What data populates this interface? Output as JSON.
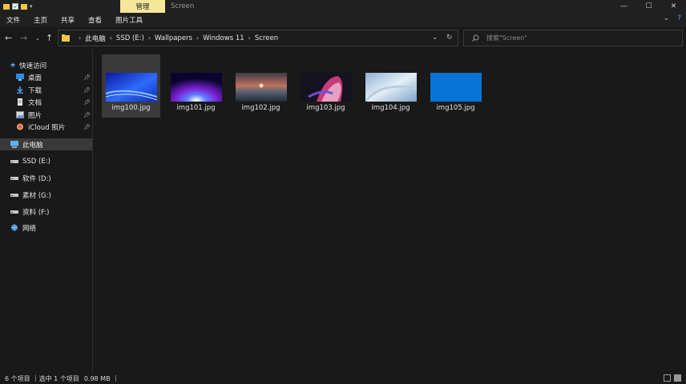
{
  "titlebar": {
    "manage_tab": "管理",
    "window_title": "Screen",
    "minimize": "—",
    "maximize": "☐",
    "close": "✕"
  },
  "ribbon": {
    "tabs": [
      "文件",
      "主页",
      "共享",
      "查看",
      "图片工具"
    ],
    "expand_glyph": "⌄",
    "help_glyph": "?"
  },
  "address": {
    "crumbs": [
      "此电脑",
      "SSD (E:)",
      "Wallpapers",
      "Windows 11",
      "Screen"
    ],
    "search_placeholder": "搜索\"Screen\""
  },
  "nav": {
    "quick_access": "快速访问",
    "desktop": "桌面",
    "downloads": "下载",
    "documents": "文档",
    "pictures": "图片",
    "icloud": "iCloud 照片",
    "this_pc": "此电脑",
    "ssd": "SSD (E:)",
    "software": "软件 (D:)",
    "material": "素材 (G:)",
    "data": "资料 (F:)",
    "network": "网络"
  },
  "files": [
    {
      "name": "img100.jpg",
      "selected": true
    },
    {
      "name": "img101.jpg",
      "selected": false
    },
    {
      "name": "img102.jpg",
      "selected": false
    },
    {
      "name": "img103.jpg",
      "selected": false
    },
    {
      "name": "img104.jpg",
      "selected": false
    },
    {
      "name": "img105.jpg",
      "selected": false
    }
  ],
  "status": {
    "count": "6 个项目",
    "selection": "选中 1 个项目",
    "size": "0.98 MB"
  },
  "colors": {
    "accent_manage": "#f4e79a",
    "background": "#191919",
    "selection": "#3a3a3a",
    "folder_yellow": "#f0c544"
  }
}
